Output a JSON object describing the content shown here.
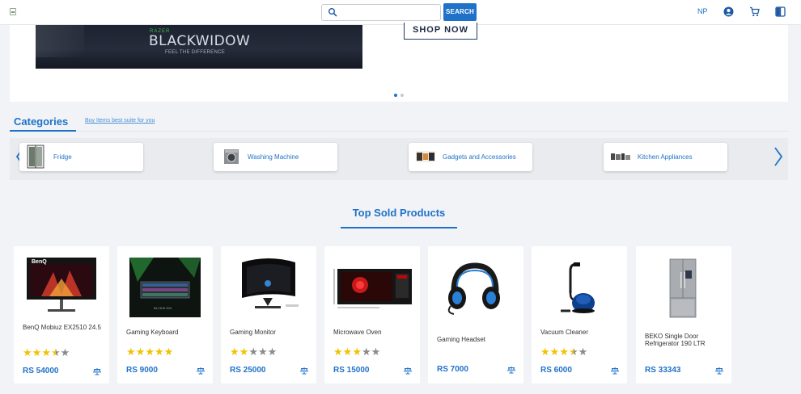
{
  "header": {
    "search_placeholder": "",
    "search_button": "SEARCH",
    "language": "NP",
    "icons": [
      "search-icon",
      "account-icon",
      "cart-icon",
      "compare-icon"
    ]
  },
  "banner": {
    "brand": "RAZER",
    "product": "BLACKWIDOW",
    "tagline": "FEEL THE DIFFERENCE",
    "cta": "SHOP NOW",
    "slides": 2,
    "active_slide": 1
  },
  "categories": {
    "title": "Categories",
    "link": "Buy Items best suite for you",
    "items": [
      {
        "label": "Fridge"
      },
      {
        "label": "Washing Machine"
      },
      {
        "label": "Gadgets and Accessories"
      },
      {
        "label": "Kitchen Appliances"
      }
    ]
  },
  "top_sold": {
    "title": "Top Sold Products",
    "products": [
      {
        "name": "BenQ Mobiuz EX2510 24.5",
        "price": "RS 54000",
        "rating": 3.5
      },
      {
        "name": "Gaming Keyboard",
        "price": "RS 9000",
        "rating": 5
      },
      {
        "name": "Gaming Monitor",
        "price": "RS 25000",
        "rating": 2
      },
      {
        "name": "Microwave Oven",
        "price": "RS 15000",
        "rating": 3
      },
      {
        "name": "Gaming Headset",
        "price": "RS 7000",
        "rating": 0
      },
      {
        "name": "Vacuum Cleaner",
        "price": "RS 6000",
        "rating": 3.5
      },
      {
        "name": "BEKO Single Door Refrigerator 190 LTR",
        "price": "RS 33343",
        "rating": 0
      }
    ]
  },
  "colors": {
    "accent": "#1f72c8",
    "star": "#f2c200",
    "background": "#f1f3f6"
  }
}
